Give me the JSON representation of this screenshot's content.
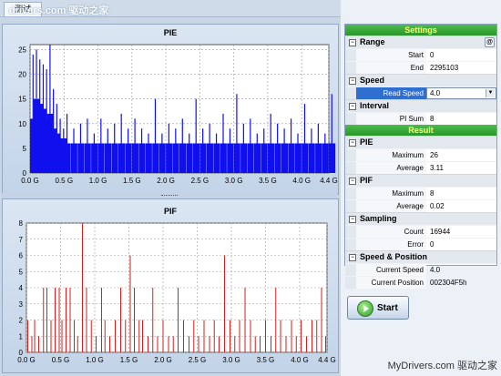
{
  "window": {
    "tab_label": "测试"
  },
  "watermark": {
    "top": "drivers.com 驱动之家",
    "bottom": "MyDrivers.com 驱动之家"
  },
  "chart_data": [
    {
      "type": "bar",
      "title": "PIE",
      "x_ticks": [
        "0.0 G",
        "0.5 G",
        "1.0 G",
        "1.5 G",
        "2.0 G",
        "2.5 G",
        "3.0 G",
        "3.5 G",
        "4.0 G",
        "4.4 G"
      ],
      "y_ticks": [
        "0",
        "5",
        "10",
        "15",
        "20",
        "25"
      ],
      "xlim": [
        0,
        4.4
      ],
      "ylim": [
        0,
        26
      ],
      "color": "#1010ee",
      "x": [
        0.0,
        0.05,
        0.1,
        0.15,
        0.2,
        0.25,
        0.3,
        0.35,
        0.4,
        0.45,
        0.5,
        0.6,
        0.7,
        0.8,
        0.9,
        1.0,
        1.1,
        1.2,
        1.3,
        1.4,
        1.5,
        1.6,
        1.7,
        1.8,
        1.9,
        2.0,
        2.1,
        2.2,
        2.3,
        2.4,
        2.5,
        2.6,
        2.7,
        2.8,
        2.9,
        3.0,
        3.1,
        3.2,
        3.3,
        3.4,
        3.5,
        3.6,
        3.7,
        3.8,
        3.9,
        4.0,
        4.1,
        4.2,
        4.3,
        4.4
      ],
      "values": [
        24,
        25,
        23,
        22,
        21,
        26,
        17,
        14,
        11,
        9,
        12,
        9,
        10,
        11,
        8,
        11,
        9,
        10,
        12,
        9,
        11,
        9,
        8,
        15,
        8,
        10,
        9,
        11,
        8,
        15,
        9,
        10,
        8,
        12,
        9,
        16,
        10,
        11,
        8,
        9,
        12,
        10,
        9,
        11,
        8,
        14,
        9,
        10,
        8,
        16
      ],
      "base": [
        11,
        15,
        14,
        13,
        11,
        12,
        9,
        8,
        7,
        7,
        6,
        6,
        6,
        6,
        6,
        6,
        6,
        6,
        6,
        6,
        6,
        6,
        6,
        6,
        6,
        6,
        6,
        6,
        6,
        6,
        6,
        6,
        6,
        6,
        6,
        6,
        6,
        6,
        6,
        6,
        6,
        6,
        6,
        6,
        6,
        6,
        6,
        6,
        6,
        6
      ]
    },
    {
      "type": "bar",
      "title": "PIF",
      "x_ticks": [
        "0.0 G",
        "0.5 G",
        "1.0 G",
        "1.5 G",
        "2.0 G",
        "2.5 G",
        "3.0 G",
        "3.5 G",
        "4.0 G",
        "4.4 G"
      ],
      "y_ticks": [
        "0",
        "1",
        "2",
        "3",
        "4",
        "5",
        "6",
        "7",
        "8"
      ],
      "xlim": [
        0,
        4.4
      ],
      "ylim": [
        0,
        8
      ],
      "color": "#cc2222",
      "x": [
        0.02,
        0.08,
        0.12,
        0.18,
        0.25,
        0.3,
        0.36,
        0.42,
        0.48,
        0.52,
        0.58,
        0.64,
        0.7,
        0.75,
        0.82,
        0.88,
        0.95,
        1.02,
        1.1,
        1.15,
        1.22,
        1.3,
        1.38,
        1.45,
        1.52,
        1.58,
        1.65,
        1.7,
        1.78,
        1.85,
        1.92,
        2.0,
        2.08,
        2.15,
        2.22,
        2.3,
        2.38,
        2.45,
        2.52,
        2.6,
        2.68,
        2.75,
        2.82,
        2.9,
        2.98,
        3.05,
        3.12,
        3.2,
        3.28,
        3.35,
        3.42,
        3.5,
        3.58,
        3.65,
        3.72,
        3.8,
        3.88,
        3.95,
        4.02,
        4.1,
        4.18,
        4.25,
        4.32,
        4.38
      ],
      "values": [
        2,
        1,
        2,
        1,
        4,
        4,
        2,
        4,
        4,
        2,
        4,
        4,
        2,
        1,
        8,
        4,
        2,
        1,
        4,
        2,
        1,
        2,
        4,
        2,
        6,
        4,
        2,
        2,
        1,
        4,
        1,
        2,
        1,
        1,
        4,
        2,
        1,
        2,
        1,
        2,
        1,
        2,
        1,
        6,
        2,
        1,
        2,
        4,
        2,
        1,
        1,
        2,
        1,
        4,
        2,
        1,
        2,
        1,
        2,
        1,
        2,
        2,
        4,
        1
      ]
    }
  ],
  "settings": {
    "header": "Settings",
    "range": {
      "label": "Range",
      "start_label": "Start",
      "start_value": "0",
      "end_label": "End",
      "end_value": "2295103"
    },
    "speed": {
      "label": "Speed",
      "read_label": "Read Speed",
      "read_value": "4.0"
    },
    "interval": {
      "label": "Interval",
      "pi_sum_label": "PI Sum",
      "pi_sum_value": "8"
    }
  },
  "result": {
    "header": "Result",
    "pie": {
      "label": "PIE",
      "max_label": "Maximum",
      "max_value": "26",
      "avg_label": "Average",
      "avg_value": "3.11"
    },
    "pif": {
      "label": "PIF",
      "max_label": "Maximum",
      "max_value": "8",
      "avg_label": "Average",
      "avg_value": "0.02"
    },
    "sampling": {
      "label": "Sampling",
      "count_label": "Count",
      "count_value": "16944",
      "error_label": "Error",
      "error_value": "0"
    },
    "speed_position": {
      "label": "Speed & Position",
      "speed_label": "Current Speed",
      "speed_value": "4.0",
      "pos_label": "Current Position",
      "pos_value": "002304F5h"
    }
  },
  "start_button": {
    "label": "Start"
  }
}
